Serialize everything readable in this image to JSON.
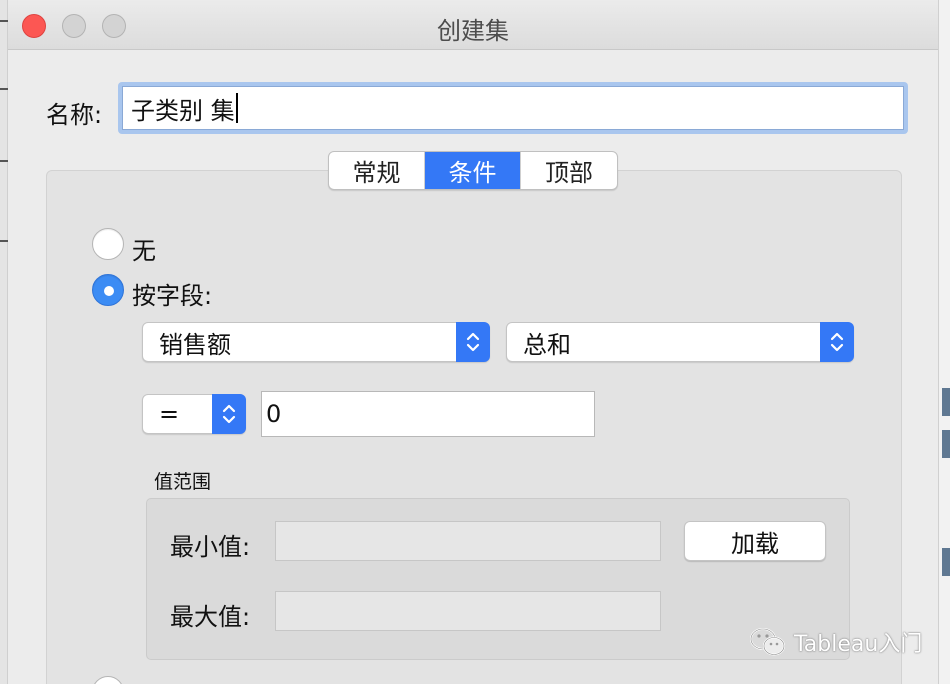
{
  "dialog": {
    "title": "创建集"
  },
  "name": {
    "label": "名称:",
    "value": "子类别 集"
  },
  "tabs": [
    {
      "label": "常规",
      "active": false
    },
    {
      "label": "条件",
      "active": true
    },
    {
      "label": "顶部",
      "active": false
    }
  ],
  "condition": {
    "options": [
      {
        "label": "无",
        "selected": false
      },
      {
        "label": "按字段:",
        "selected": true
      }
    ],
    "field_select": "销售额",
    "aggregation_select": "总和",
    "operator_select": "=",
    "value_input": "0",
    "range": {
      "group_label": "值范围",
      "min_label": "最小值:",
      "max_label": "最大值:",
      "load_button": "加载"
    }
  },
  "watermark": {
    "text": "Tableau入门",
    "icon": "wechat-icon"
  },
  "colors": {
    "accent": "#3478f6",
    "close": "#fc5753"
  }
}
